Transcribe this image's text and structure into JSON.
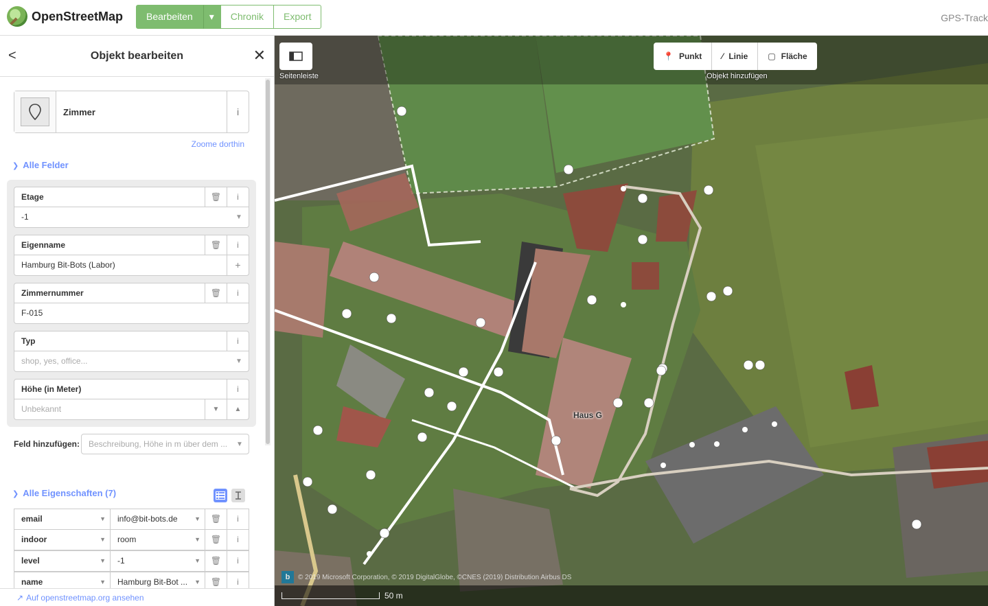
{
  "app": {
    "name": "OpenStreetMap"
  },
  "nav": {
    "edit": "Bearbeiten",
    "history": "Chronik",
    "export": "Export",
    "gps": "GPS-Track"
  },
  "sidebar": {
    "title": "Objekt bearbeiten",
    "preset_name": "Zimmer",
    "zoom_link": "Zoome dorthin",
    "all_fields": "Alle Felder",
    "fields": [
      {
        "label": "Etage",
        "value": "-1",
        "placeholder": ""
      },
      {
        "label": "Eigenname",
        "value": "Hamburg Bit-Bots (Labor)",
        "placeholder": ""
      },
      {
        "label": "Zimmernummer",
        "value": "F-015",
        "placeholder": ""
      },
      {
        "label": "Typ",
        "value": "",
        "placeholder": "shop, yes, office..."
      },
      {
        "label": "Höhe (in Meter)",
        "value": "",
        "placeholder": "Unbekannt"
      }
    ],
    "add_field_label": "Feld hinzufügen:",
    "add_field_placeholder": "Beschreibung, Höhe in m über dem ...",
    "all_tags": "Alle Eigenschaften (7)",
    "tags": [
      {
        "key": "email",
        "value": "info@bit-bots.de"
      },
      {
        "key": "indoor",
        "value": "room"
      },
      {
        "key": "level",
        "value": "-1"
      },
      {
        "key": "name",
        "value": "Hamburg Bit-Bot ..."
      }
    ],
    "osm_link": "Auf openstreetmap.org ansehen"
  },
  "map": {
    "sidebar_toggle_label": "Seitenleiste",
    "modes": {
      "point": "Punkt",
      "line": "Linie",
      "area": "Fläche"
    },
    "add_caption": "Objekt hinzufügen",
    "building_label": "Haus G",
    "attribution": "© 2019 Microsoft Corporation, © 2019 DigitalGlobe, ©CNES (2019) Distribution Airbus DS",
    "scale": "50 m"
  },
  "colors": {
    "accent": "#7ebc6f",
    "link": "#7092ff"
  }
}
